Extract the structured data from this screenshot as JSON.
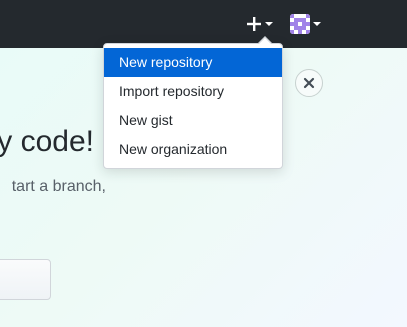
{
  "header": {
    "create_icon": "plus-icon",
    "avatar_icon": "identicon-avatar"
  },
  "create_menu": {
    "items": [
      {
        "label": "New repository",
        "active": true
      },
      {
        "label": "Import repository",
        "active": false
      },
      {
        "label": "New gist",
        "active": false
      },
      {
        "label": "New organization",
        "active": false
      }
    ]
  },
  "hero": {
    "title_fragment": "y code!",
    "text_fragment": "tart a branch,",
    "close_icon": "close-icon"
  },
  "colors": {
    "topbar": "#24292e",
    "accent": "#0366d6",
    "avatar": "#a182e8"
  }
}
